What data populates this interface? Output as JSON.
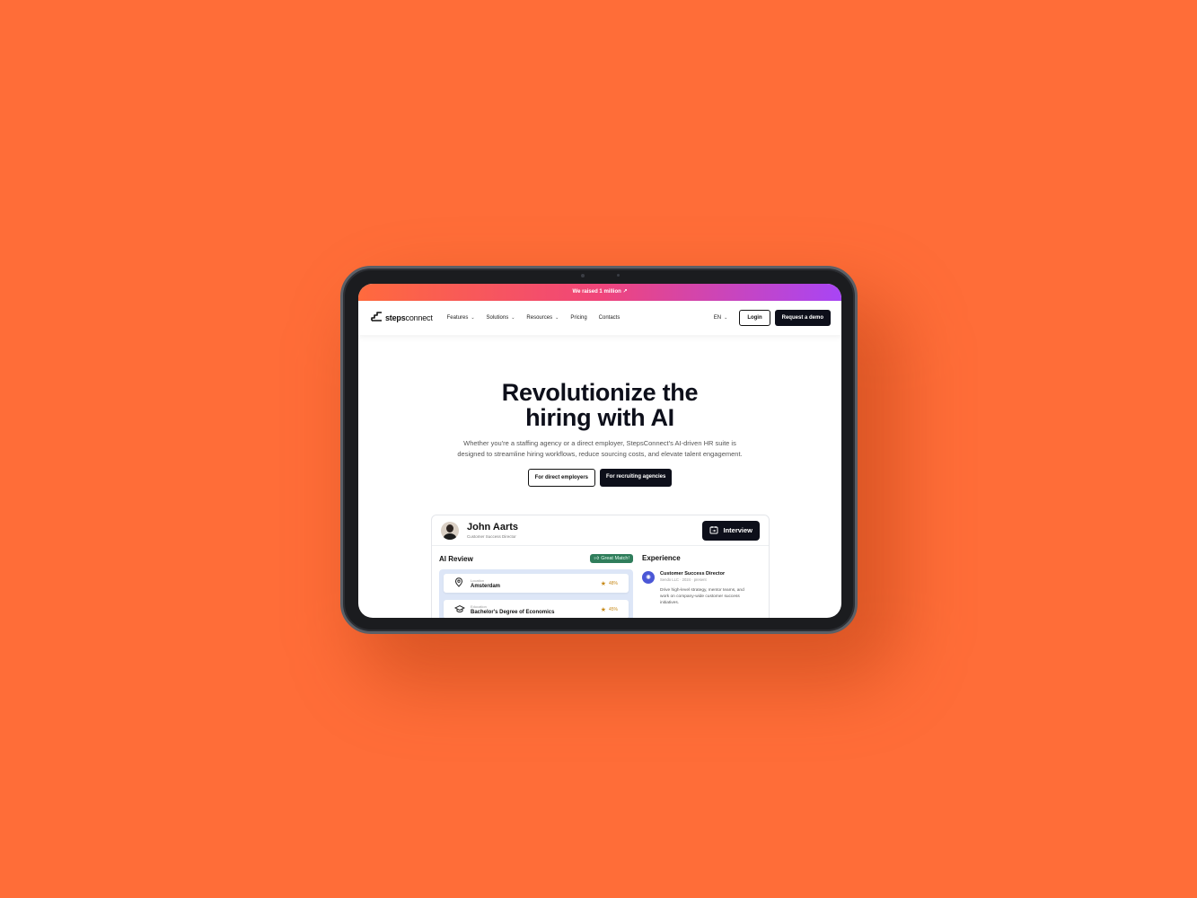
{
  "announcement": "We raised 1 million ↗",
  "brand": {
    "bold": "steps",
    "light": "connect"
  },
  "nav": {
    "items": [
      {
        "label": "Features",
        "chevron": true
      },
      {
        "label": "Solutions",
        "chevron": true
      },
      {
        "label": "Resources",
        "chevron": true
      },
      {
        "label": "Pricing",
        "chevron": false
      },
      {
        "label": "Contacts",
        "chevron": false
      }
    ],
    "language": "EN",
    "login": "Login",
    "demo": "Request a demo"
  },
  "hero": {
    "title_line1": "Revolutionize the",
    "title_line2": "hiring with AI",
    "description": "Whether you're a staffing agency or a direct employer, StepsConnect's AI-driven HR suite is designed to streamline hiring workflows, reduce sourcing costs, and elevate talent engagement.",
    "btn_employers": "For direct employers",
    "btn_agencies": "For recruiting agencies"
  },
  "candidate": {
    "name": "John Aarts",
    "role": "Customer Success Director",
    "interview_btn": "Interview",
    "ai_review": {
      "title": "AI Review",
      "badge": "Great Match!",
      "rows": [
        {
          "label": "Location",
          "value": "Amsterdam",
          "score": "48%",
          "icon": "map-pin-icon"
        },
        {
          "label": "Education",
          "value": "Bachelor's Degree of Economics",
          "score": "45%",
          "icon": "graduation-cap-icon"
        }
      ]
    },
    "experience": {
      "title": "Experience",
      "items": [
        {
          "title": "Customer Success Director",
          "sub": "Sendo LLC · 2024 · present",
          "desc": "Drive high-level strategy, mentor teams, and work on company-wide customer success initiatives."
        }
      ]
    }
  },
  "colors": {
    "background": "#ff6d38",
    "accent_dark": "#0d0f1a",
    "gradient_start": "#ff6a3d",
    "gradient_end": "#a845f5",
    "badge_green": "#2f7d5b"
  }
}
